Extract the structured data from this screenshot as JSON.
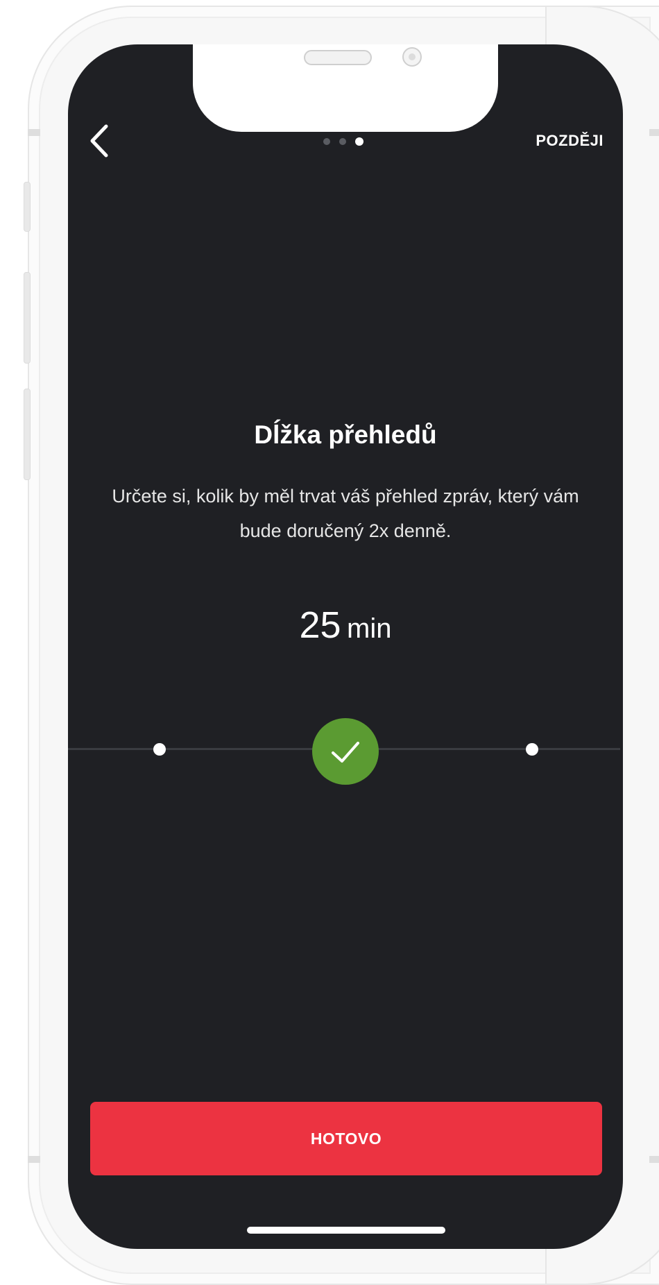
{
  "header": {
    "back_icon": "chevron-left-icon",
    "later_label": "POZDĚJI",
    "pager": {
      "count": 3,
      "active": 3
    }
  },
  "content": {
    "title": "Dĺžka přehledů",
    "description": "Určete si, kolik by měl trvat váš přehled zpráv, který vám bude doručený 2x denně.",
    "value_number": "25",
    "value_unit": "min"
  },
  "slider": {
    "stops": 3,
    "selected_index": 1,
    "knob_icon": "check-icon"
  },
  "footer": {
    "done_label": "HOTOVO"
  },
  "colors": {
    "background": "#1f2024",
    "accent_red": "#ec3341",
    "accent_green": "#5b9b32"
  }
}
